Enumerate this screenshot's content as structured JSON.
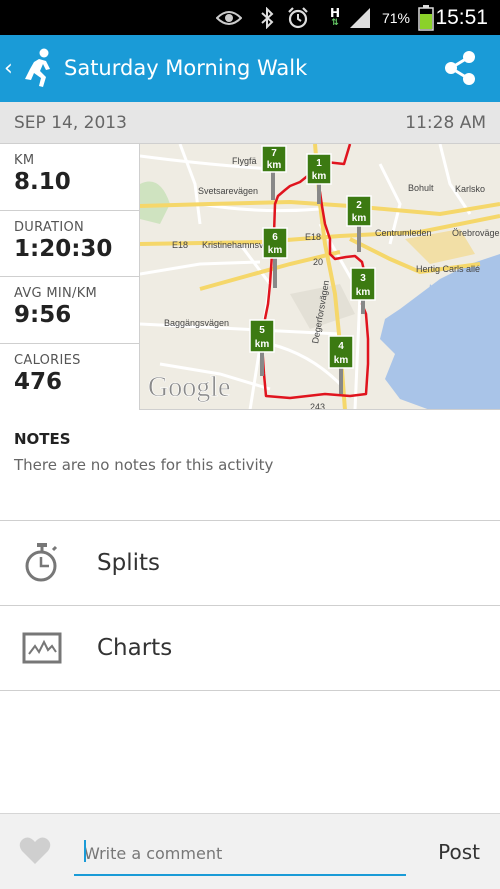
{
  "status_bar": {
    "battery_percent": "71%",
    "time": "15:51",
    "network_type": "H",
    "icons": [
      "eye-icon",
      "bluetooth-icon",
      "alarm-icon",
      "network-h-icon",
      "signal-icon",
      "battery-icon"
    ]
  },
  "app_bar": {
    "back_glyph": "‹",
    "title": "Saturday Morning Walk",
    "icons": {
      "activity": "runner-icon",
      "share": "share-icon"
    },
    "accent_color": "#1a9bd7"
  },
  "activity": {
    "date": "SEP 14, 2013",
    "time": "11:28 AM"
  },
  "stats": [
    {
      "label": "KM",
      "value": "8.10"
    },
    {
      "label": "DURATION",
      "value": "1:20:30"
    },
    {
      "label": "AVG MIN/KM",
      "value": "9:56"
    },
    {
      "label": "CALORIES",
      "value": "476"
    }
  ],
  "map": {
    "attribution": "Google",
    "place_labels": [
      "Flygfä",
      "Svetsarevägen",
      "Bohult",
      "Karlsko",
      "Centrumleden",
      "Örebrovägen",
      "Kristinehamnsv",
      "E18",
      "E18",
      "Hertig Carls allé",
      "Baggängsvägen",
      "Degerforsvägen",
      "20",
      "243"
    ],
    "km_markers": [
      {
        "number": "7",
        "unit": "km"
      },
      {
        "number": "1",
        "unit": "km"
      },
      {
        "number": "2",
        "unit": "km"
      },
      {
        "number": "6",
        "unit": "km"
      },
      {
        "number": "3",
        "unit": "km"
      },
      {
        "number": "5",
        "unit": "km"
      },
      {
        "number": "4",
        "unit": "km"
      }
    ],
    "route_color": "#e0141e",
    "marker_color": "#3c7a12"
  },
  "notes": {
    "heading": "NOTES",
    "text": "There are no notes for this activity"
  },
  "menu": [
    {
      "label": "Splits",
      "icon": "stopwatch-icon"
    },
    {
      "label": "Charts",
      "icon": "chart-icon"
    }
  ],
  "comment": {
    "placeholder": "Write a comment",
    "value": "",
    "post_label": "Post",
    "like_icon": "heart-icon"
  }
}
